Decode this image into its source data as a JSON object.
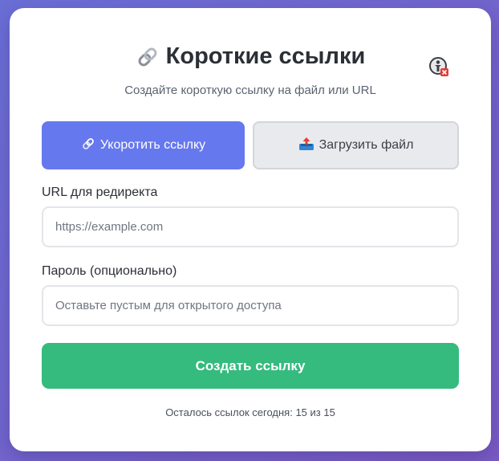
{
  "header": {
    "title": "Короткие ссылки",
    "subtitle": "Создайте короткую ссылку на файл или URL"
  },
  "tabs": [
    {
      "label": "Укоротить ссылку",
      "icon": "link-icon",
      "active": true
    },
    {
      "label": "Загрузить файл",
      "icon": "upload-tray-icon",
      "active": false
    }
  ],
  "form": {
    "url_label": "URL для редиректа",
    "url_placeholder": "https://example.com",
    "url_value": "",
    "password_label": "Пароль (опционально)",
    "password_placeholder": "Оставьте пустым для открытого доступа",
    "password_value": "",
    "submit_label": "Создать ссылку"
  },
  "footer": {
    "remaining_text": "Осталось ссылок сегодня: 15 из 15"
  },
  "colors": {
    "primary": "#6678ee",
    "success": "#34bb7d",
    "background_gradient_start": "#6a6fd6",
    "background_gradient_end": "#7a5bc4"
  },
  "icons": {
    "title_icon": "link-icon",
    "badge_icon": "extension-disabled-icon"
  }
}
